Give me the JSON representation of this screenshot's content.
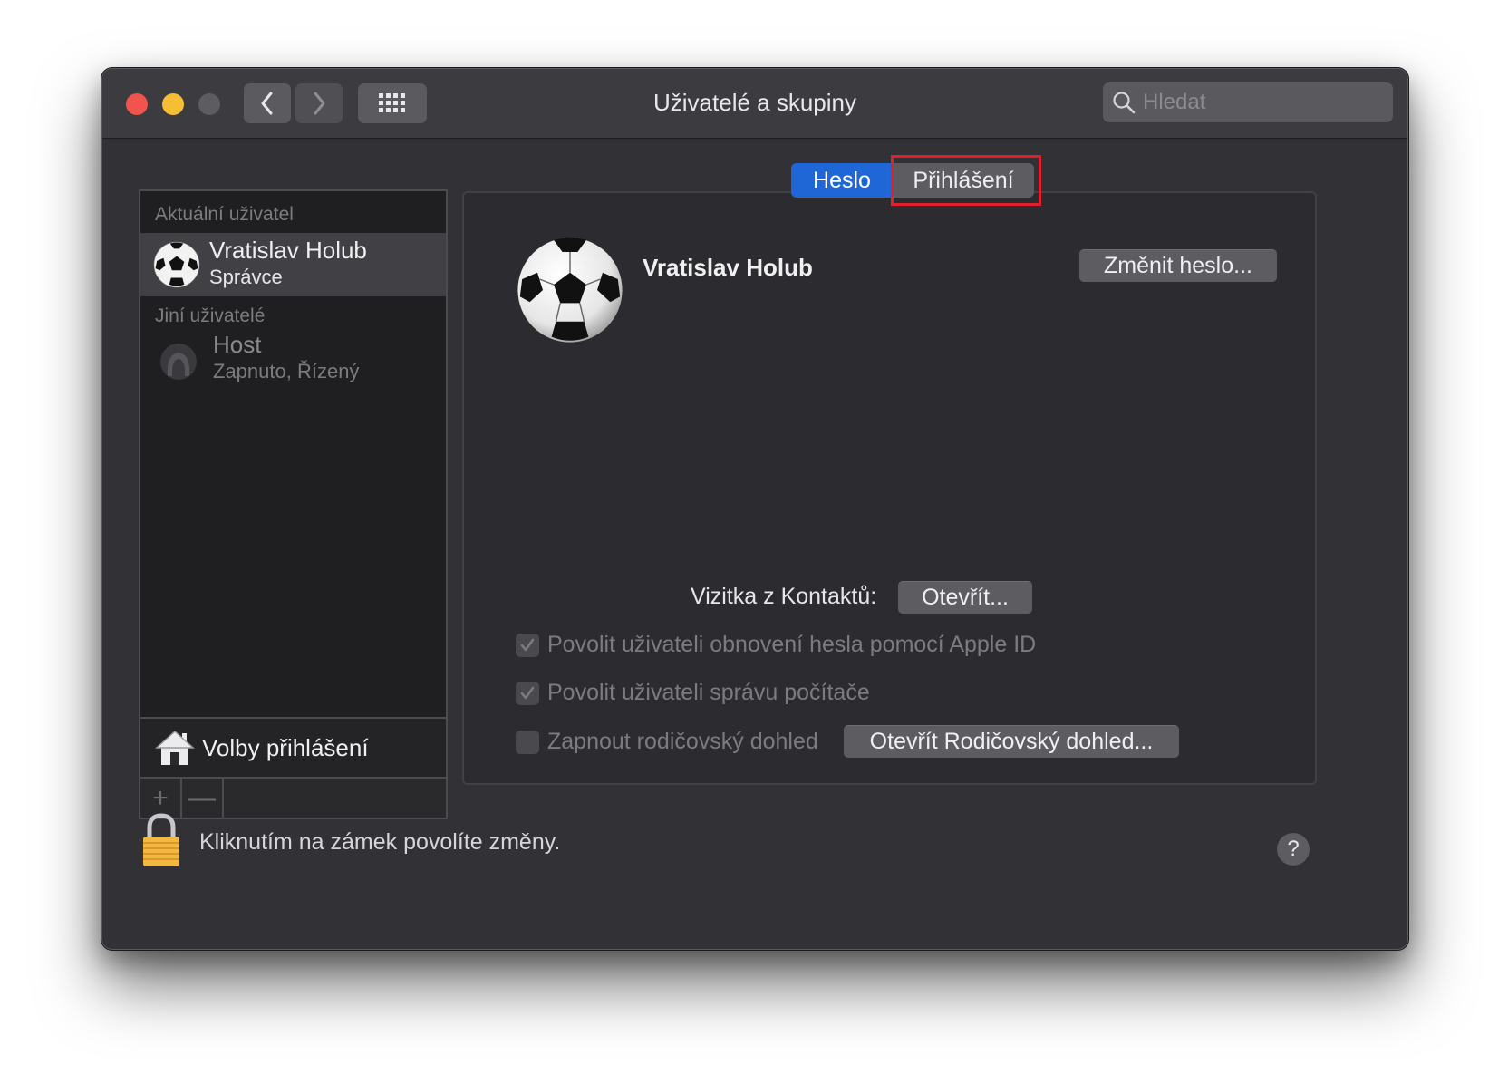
{
  "window": {
    "title": "Uživatelé a skupiny",
    "search_placeholder": "Hledat"
  },
  "toolbar": {
    "icons": [
      "back-chevron-icon",
      "forward-chevron-icon",
      "grid-icon"
    ]
  },
  "sidebar": {
    "current_header": "Aktuální uživatel",
    "current_user": {
      "name": "Vratislav Holub",
      "role": "Správce"
    },
    "others_header": "Jiní uživatelé",
    "guest": {
      "name": "Host",
      "status": "Zapnuto, Řízený"
    },
    "login_options_label": "Volby přihlášení",
    "add_label": "+",
    "remove_label": "—"
  },
  "tabs": [
    {
      "label": "Heslo",
      "active": true
    },
    {
      "label": "Přihlášení",
      "active": false,
      "highlighted": true
    }
  ],
  "main": {
    "user_name": "Vratislav Holub",
    "change_password_button": "Změnit heslo...",
    "contacts_label": "Vizitka z Kontaktů:",
    "open_button": "Otevřít...",
    "checkboxes": [
      {
        "label": "Povolit uživateli obnovení hesla pomocí Apple ID",
        "checked": true,
        "enabled": false
      },
      {
        "label": "Povolit uživateli správu počítače",
        "checked": true,
        "enabled": false
      },
      {
        "label": "Zapnout rodičovský dohled",
        "checked": false,
        "enabled": false
      }
    ],
    "parental_button": "Otevřít Rodičovský dohled..."
  },
  "footer": {
    "lock_text": "Kliknutím na zámek povolíte změny.",
    "help_label": "?"
  },
  "colors": {
    "accent": "#1f66d6",
    "highlight_box": "#e0212b",
    "close": "#f0544c",
    "minimize": "#f6bf33"
  }
}
